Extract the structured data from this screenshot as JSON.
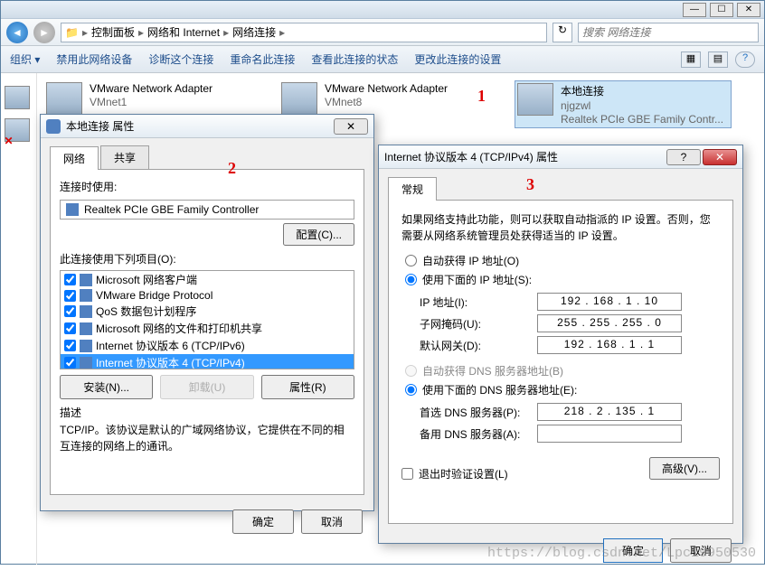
{
  "titlebar": {
    "min": "—",
    "max": "☐",
    "close": "✕"
  },
  "nav": {
    "breadcrumb": [
      "控制面板",
      "网络和 Internet",
      "网络连接"
    ],
    "search_placeholder": "搜索 网络连接"
  },
  "toolbar": {
    "organize": "组织 ▾",
    "items": [
      "禁用此网络设备",
      "诊断这个连接",
      "重命名此连接",
      "查看此连接的状态",
      "更改此连接的设置"
    ]
  },
  "connections": [
    {
      "name": "VMware Network Adapter",
      "sub1": "VMnet1",
      "sub2": ""
    },
    {
      "name": "VMware Network Adapter",
      "sub1": "VMnet8",
      "sub2": ""
    },
    {
      "name": "本地连接",
      "sub1": "njgzwl",
      "sub2": "Realtek PCIe GBE Family Contr..."
    }
  ],
  "dlg1": {
    "title": "本地连接 属性",
    "tabs": [
      "网络",
      "共享"
    ],
    "connect_using": "连接时使用:",
    "adapter": "Realtek PCIe GBE Family Controller",
    "configure": "配置(C)...",
    "uses_items": "此连接使用下列项目(O):",
    "items": [
      "Microsoft 网络客户端",
      "VMware Bridge Protocol",
      "QoS 数据包计划程序",
      "Microsoft 网络的文件和打印机共享",
      "Internet 协议版本 6 (TCP/IPv6)",
      "Internet 协议版本 4 (TCP/IPv4)"
    ],
    "install": "安装(N)...",
    "uninstall": "卸载(U)",
    "properties": "属性(R)",
    "desc_label": "描述",
    "desc_text": "TCP/IP。该协议是默认的广域网络协议，它提供在不同的相互连接的网络上的通讯。",
    "ok": "确定",
    "cancel": "取消"
  },
  "dlg2": {
    "title": "Internet 协议版本 4 (TCP/IPv4) 属性",
    "tab": "常规",
    "info": "如果网络支持此功能，则可以获取自动指派的 IP 设置。否则，您需要从网络系统管理员处获得适当的 IP 设置。",
    "auto_ip": "自动获得 IP 地址(O)",
    "use_ip": "使用下面的 IP 地址(S):",
    "ip_label": "IP 地址(I):",
    "ip_value": "192 . 168 .  1  . 10",
    "mask_label": "子网掩码(U):",
    "mask_value": "255 . 255 . 255 .  0",
    "gw_label": "默认网关(D):",
    "gw_value": "192 . 168 .  1  .  1",
    "auto_dns": "自动获得 DNS 服务器地址(B)",
    "use_dns": "使用下面的 DNS 服务器地址(E):",
    "dns1_label": "首选 DNS 服务器(P):",
    "dns1_value": "218 .  2  . 135 .  1",
    "dns2_label": "备用 DNS 服务器(A):",
    "dns2_value": "",
    "exit_validate": "退出时验证设置(L)",
    "advanced": "高级(V)...",
    "ok": "确定",
    "cancel": "取消"
  },
  "markers": {
    "m1": "1",
    "m2": "2",
    "m3": "3"
  },
  "watermark": "https://blog.csdn.net/Lpc19950530"
}
